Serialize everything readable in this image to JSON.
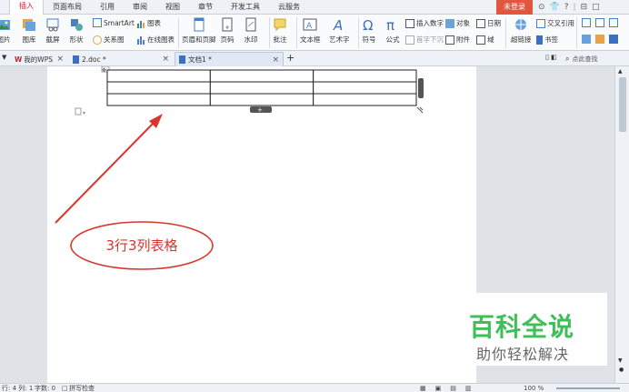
{
  "menu": {
    "tabs": [
      "插入",
      "页面布局",
      "引用",
      "审阅",
      "视图",
      "章节",
      "开发工具",
      "云服务"
    ],
    "active_tab": "插入",
    "login_label": "未登录",
    "right_icons": [
      "share-icon",
      "skin-icon",
      "help-icon",
      "collapse-icon"
    ]
  },
  "ribbon": {
    "picture": "图片",
    "gallery": "图库",
    "screenshot": "截屏",
    "shape": "形状",
    "smartart": "SmartArt",
    "chart": "图表",
    "relation": "关系图",
    "online_chart": "在线图表",
    "header_footer": "页眉和页脚",
    "page_number": "页码",
    "watermark": "水印",
    "comment": "批注",
    "textbox": "文本框",
    "art_text": "艺术字",
    "symbol": "符号",
    "formula": "公式",
    "insert_number": "插入数字",
    "object": "对象",
    "date": "日期",
    "drop_cap": "首字下沉",
    "attachment": "附件",
    "field": "域",
    "hyperlink": "超链接",
    "cross_ref": "交叉引用",
    "bookmark": "书签"
  },
  "doc_tabs": {
    "items": [
      {
        "label": "我的WPS",
        "close": "×"
      },
      {
        "label": "2.doc *",
        "close": "×"
      },
      {
        "label": "文档1 *",
        "close": "×"
      }
    ],
    "add": "+",
    "search_placeholder": "点此查找"
  },
  "document": {
    "table_rows": 3,
    "table_cols": 3,
    "annotation_text": "3行3列表格",
    "annotation_color": "#d9352b",
    "add_row": "+"
  },
  "statusbar": {
    "position": "行: 4  列: 1",
    "word_count": "字数: 0",
    "spell_check": "拼写检查",
    "zoom": "100 %"
  },
  "watermark_logo": {
    "title": "百科全说",
    "subtitle": "助你轻松解决",
    "color": "#3fbf5a"
  }
}
